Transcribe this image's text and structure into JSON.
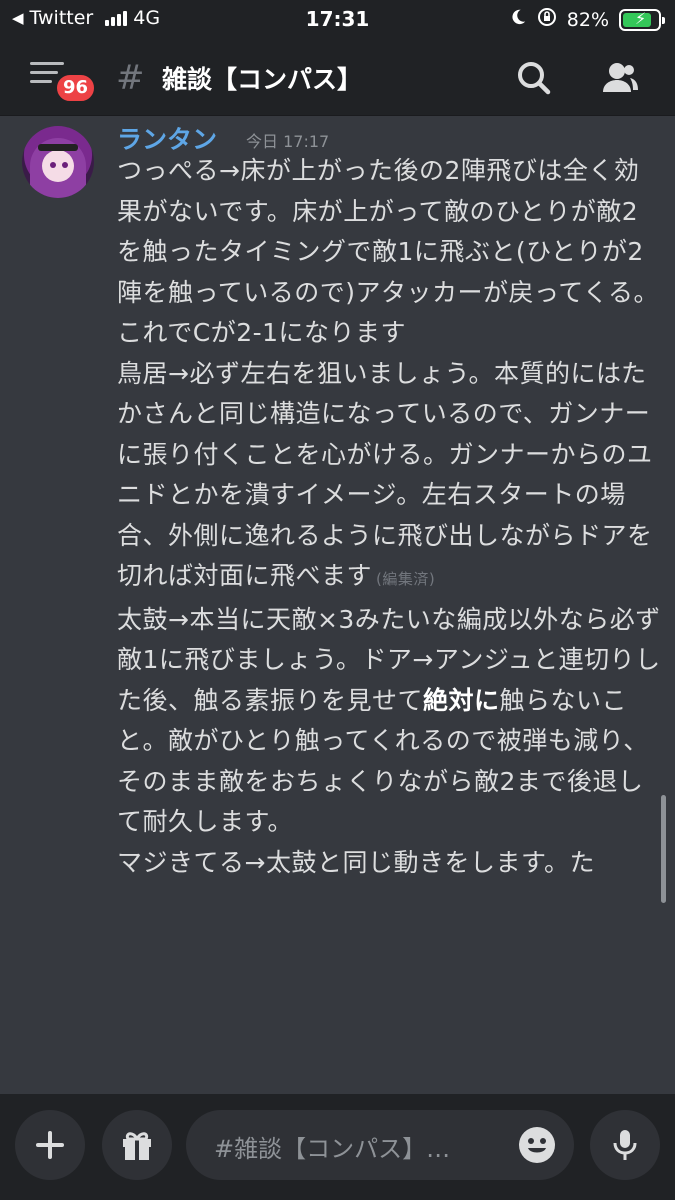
{
  "status_bar": {
    "back_app": "Twitter",
    "network": "4G",
    "time": "17:31",
    "battery": "82%",
    "battery_level": 0.82
  },
  "header": {
    "unread_badge": "96",
    "channel_name": "雑談【コンパス】"
  },
  "message": {
    "author": "ランタン",
    "timestamp": "今日 17:17",
    "paragraphs": [
      "つっぺる→床が上がった後の2陣飛びは全く効果がないです。床が上がって敵のひとりが敵2を触ったタイミングで敵1に飛ぶと(ひとりが2陣を触っているので)アタッカーが戻ってくる。これでCが2-1になります",
      "鳥居→必ず左右を狙いましょう。本質的にはたかさんと同じ構造になっているので、ガンナーに張り付くことを心がける。ガンナーからのユニドとかを潰すイメージ。左右スタートの場合、外側に逸れるように飛び出しながらドアを切れば対面に飛べます",
      "太鼓→本当に天敵×3みたいな編成以外なら必ず敵1に飛びましょう。ドア→アンジュと連切りした後、触る素振りを見せて",
      "絶対に",
      "触らないこと。敵がひとり触ってくれるので被弾も減り、そのまま敵をおちょくりながら敵2まで後退して耐久します。",
      "マジきてる→太鼓と同じ動きをします。た"
    ],
    "edited_label": "(編集済)"
  },
  "composer": {
    "placeholder": "#雑談【コンパス】…"
  },
  "colors": {
    "background": "#36393f",
    "bars": "#202225",
    "username": "#5ea6e6",
    "badge": "#ed4245"
  }
}
